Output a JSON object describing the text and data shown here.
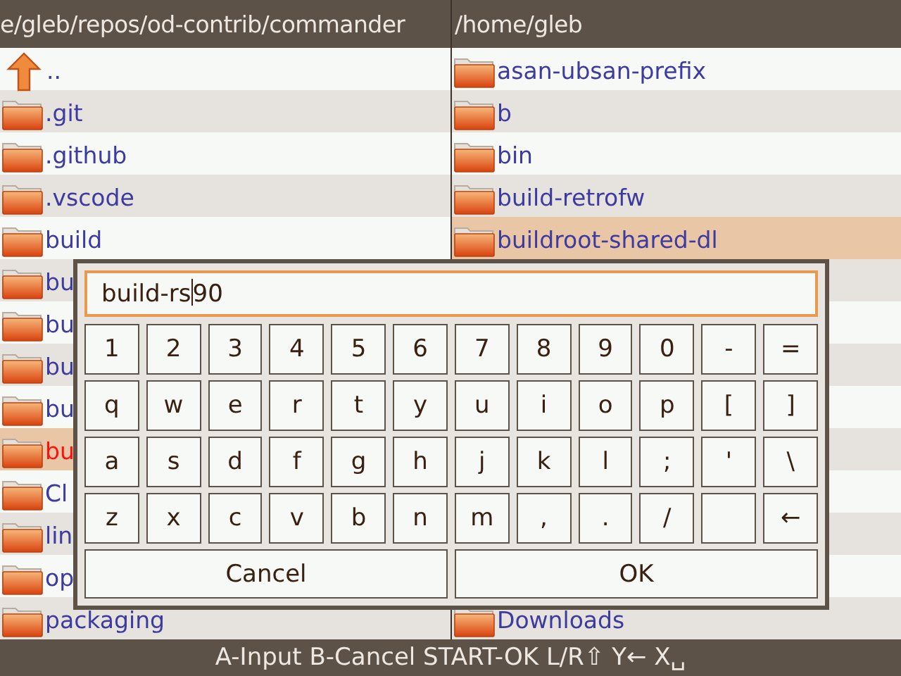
{
  "left_panel": {
    "path": "e/gleb/repos/od-contrib/commander",
    "items": [
      {
        "name": "..",
        "kind": "parent",
        "cursor": false,
        "marked": false
      },
      {
        "name": ".git",
        "kind": "folder",
        "cursor": false,
        "marked": false
      },
      {
        "name": ".github",
        "kind": "folder",
        "cursor": false,
        "marked": false
      },
      {
        "name": ".vscode",
        "kind": "folder",
        "cursor": false,
        "marked": false
      },
      {
        "name": "build",
        "kind": "folder",
        "cursor": false,
        "marked": false
      },
      {
        "name": "bu",
        "kind": "folder",
        "cursor": false,
        "marked": false
      },
      {
        "name": "bu",
        "kind": "folder",
        "cursor": false,
        "marked": false
      },
      {
        "name": "bu",
        "kind": "folder",
        "cursor": false,
        "marked": false
      },
      {
        "name": "bu",
        "kind": "folder",
        "cursor": false,
        "marked": false
      },
      {
        "name": "bu",
        "kind": "folder",
        "cursor": true,
        "marked": true
      },
      {
        "name": "Cl",
        "kind": "folder",
        "cursor": false,
        "marked": false
      },
      {
        "name": "lin",
        "kind": "folder",
        "cursor": false,
        "marked": false
      },
      {
        "name": "op",
        "kind": "folder",
        "cursor": false,
        "marked": false
      },
      {
        "name": "packaging",
        "kind": "folder",
        "cursor": false,
        "marked": false
      }
    ]
  },
  "right_panel": {
    "path": "/home/gleb",
    "items": [
      {
        "name": "asan-ubsan-prefix",
        "kind": "folder",
        "cursor": false,
        "marked": false
      },
      {
        "name": "b",
        "kind": "folder",
        "cursor": false,
        "marked": false
      },
      {
        "name": "bin",
        "kind": "folder",
        "cursor": false,
        "marked": false
      },
      {
        "name": "build-retrofw",
        "kind": "folder",
        "cursor": false,
        "marked": false
      },
      {
        "name": "buildroot-shared-dl",
        "kind": "folder",
        "cursor": true,
        "marked": false
      }
    ],
    "bottom_items": [
      {
        "name": "Downloads",
        "kind": "folder",
        "cursor": false,
        "marked": false
      }
    ]
  },
  "dialog": {
    "text_before_cursor": "build-rs",
    "text_after_cursor": "90",
    "keys": [
      {
        "kind": "char",
        "label": "1"
      },
      {
        "kind": "char",
        "label": "2"
      },
      {
        "kind": "char",
        "label": "3"
      },
      {
        "kind": "char",
        "label": "4"
      },
      {
        "kind": "char",
        "label": "5"
      },
      {
        "kind": "char",
        "label": "6"
      },
      {
        "kind": "char",
        "label": "7"
      },
      {
        "kind": "char",
        "label": "8"
      },
      {
        "kind": "char",
        "label": "9"
      },
      {
        "kind": "char",
        "label": "0"
      },
      {
        "kind": "char",
        "label": "-"
      },
      {
        "kind": "char",
        "label": "="
      },
      {
        "kind": "char",
        "label": "q"
      },
      {
        "kind": "char",
        "label": "w"
      },
      {
        "kind": "char",
        "label": "e"
      },
      {
        "kind": "char",
        "label": "r"
      },
      {
        "kind": "char",
        "label": "t"
      },
      {
        "kind": "char",
        "label": "y"
      },
      {
        "kind": "char",
        "label": "u"
      },
      {
        "kind": "char",
        "label": "i"
      },
      {
        "kind": "char",
        "label": "o"
      },
      {
        "kind": "char",
        "label": "p"
      },
      {
        "kind": "char",
        "label": "["
      },
      {
        "kind": "char",
        "label": "]"
      },
      {
        "kind": "char",
        "label": "a"
      },
      {
        "kind": "char",
        "label": "s"
      },
      {
        "kind": "char",
        "label": "d"
      },
      {
        "kind": "char",
        "label": "f"
      },
      {
        "kind": "char",
        "label": "g"
      },
      {
        "kind": "char",
        "label": "h"
      },
      {
        "kind": "char",
        "label": "j"
      },
      {
        "kind": "char",
        "label": "k"
      },
      {
        "kind": "char",
        "label": "l"
      },
      {
        "kind": "char",
        "label": ";"
      },
      {
        "kind": "char",
        "label": "'"
      },
      {
        "kind": "char",
        "label": "\\"
      },
      {
        "kind": "char",
        "label": "z"
      },
      {
        "kind": "char",
        "label": "x"
      },
      {
        "kind": "char",
        "label": "c"
      },
      {
        "kind": "char",
        "label": "v"
      },
      {
        "kind": "char",
        "label": "b"
      },
      {
        "kind": "char",
        "label": "n"
      },
      {
        "kind": "char",
        "label": "m"
      },
      {
        "kind": "char",
        "label": ","
      },
      {
        "kind": "char",
        "label": "."
      },
      {
        "kind": "char",
        "label": "/"
      },
      {
        "kind": "space"
      },
      {
        "kind": "char",
        "label": "←"
      }
    ],
    "buttons": [
      "Cancel",
      "OK"
    ]
  },
  "status_bar": "A-Input B-Cancel START-OK L/R⇧ Y← X␣"
}
